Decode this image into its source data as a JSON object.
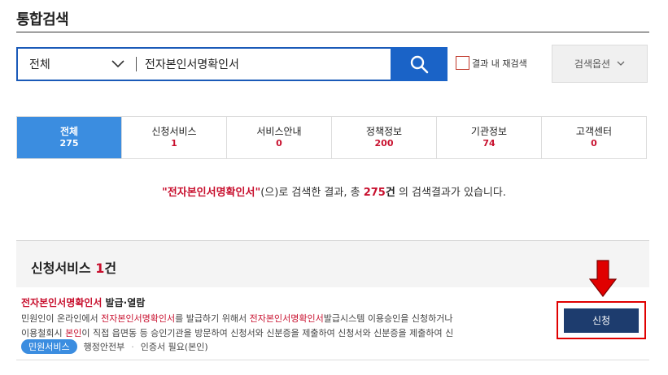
{
  "page": {
    "title": "통합검색"
  },
  "search": {
    "scope_label": "전체",
    "query": "전자본인서명확인서"
  },
  "research": {
    "label": "결과 내 재검색"
  },
  "options": {
    "label": "검색옵션"
  },
  "tabs": [
    {
      "label": "전체",
      "count": "275"
    },
    {
      "label": "신청서비스",
      "count": "1"
    },
    {
      "label": "서비스안내",
      "count": "0"
    },
    {
      "label": "정책정보",
      "count": "200"
    },
    {
      "label": "기관정보",
      "count": "74"
    },
    {
      "label": "고객센터",
      "count": "0"
    }
  ],
  "summary": {
    "open_quote": "\"",
    "query": "전자본인서명확인서",
    "close_quote": "\"",
    "mid": "(으)로 검색한 결과, 총 ",
    "total": "275",
    "unit": "건",
    "tail": " 의 검색결과가 있습니다."
  },
  "section": {
    "title": "신청서비스",
    "count": "1",
    "unit": "건"
  },
  "result": {
    "title_hl": "전자본인서명확인서",
    "title_rest": " 발급·열람",
    "desc1_a": "민원인이 온라인에서 ",
    "desc1_hl1": "전자본인서명확인서",
    "desc1_b": "를 발급하기 위해서 ",
    "desc1_hl2": "전자본인서명확인서",
    "desc1_c": "발급시스템 이용승인을 신청하거나",
    "desc2_a": "이용철회시 ",
    "desc2_hl": "본인",
    "desc2_b": "이 직접 읍면동 등 승인기관을 방문하여 신청서와 신분증을 제출하여 신청서와 신분증을 제출하여 신",
    "badge": "민원서비스",
    "agency": "행정안전부",
    "dot": "·",
    "cert": "인증서 필요(본인)",
    "apply_label": "신청"
  },
  "colors": {
    "accent_blue": "#1a63c7",
    "active_tab": "#3b8de0",
    "highlight_red": "#c8102e",
    "apply_navy": "#1d3c6e",
    "callout_red": "#e00000"
  }
}
